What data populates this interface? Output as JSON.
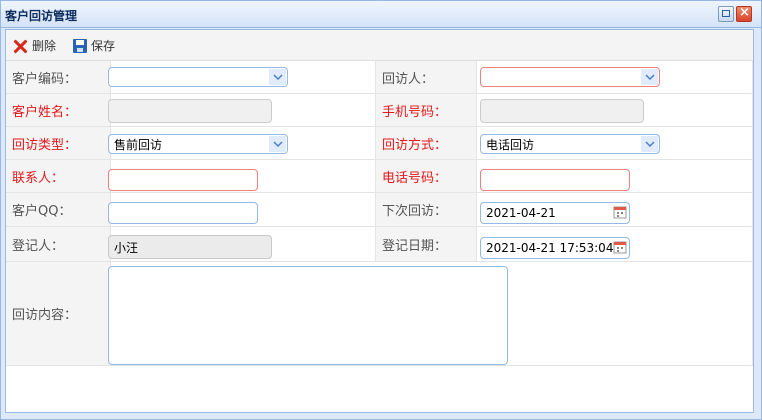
{
  "window": {
    "title": "客户回访管理"
  },
  "toolbar": {
    "delete_label": "删除",
    "save_label": "保存"
  },
  "form": {
    "customer_code": {
      "label": "客户编码：",
      "value": ""
    },
    "visitor": {
      "label": "回访人：",
      "value": ""
    },
    "customer_name": {
      "label": "客户姓名：",
      "value": ""
    },
    "mobile": {
      "label": "手机号码：",
      "value": ""
    },
    "visit_type": {
      "label": "回访类型：",
      "value": "售前回访"
    },
    "visit_method": {
      "label": "回访方式：",
      "value": "电话回访"
    },
    "contact": {
      "label": "联系人：",
      "value": ""
    },
    "phone": {
      "label": "电话号码：",
      "value": ""
    },
    "customer_qq": {
      "label": "客户QQ：",
      "value": ""
    },
    "next_visit": {
      "label": "下次回访：",
      "value": "2021-04-21"
    },
    "registrar": {
      "label": "登记人：",
      "value": "小汪"
    },
    "register_date": {
      "label": "登记日期：",
      "value": "2021-04-21 17:53:04"
    },
    "content": {
      "label": "回访内容：",
      "value": ""
    }
  },
  "colors": {
    "required_label": "#e4181c",
    "field_border": "#95b8e7",
    "error_border": "#f08080"
  }
}
